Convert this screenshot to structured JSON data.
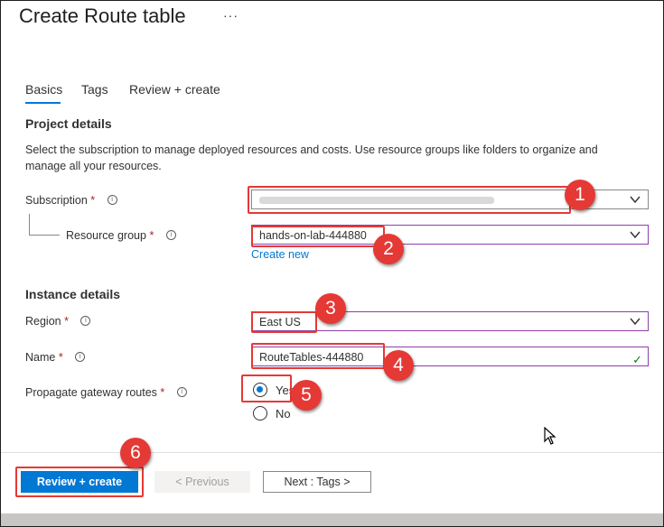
{
  "page_title": "Create Route table",
  "more_label": "···",
  "tabs": [
    {
      "label": "Basics",
      "active": true
    },
    {
      "label": "Tags",
      "active": false
    },
    {
      "label": "Review + create",
      "active": false
    }
  ],
  "project_details": {
    "heading": "Project details",
    "description": "Select the subscription to manage deployed resources and costs. Use resource groups like folders to organize and manage all your resources.",
    "subscription": {
      "label": "Subscription",
      "required": "*"
    },
    "resource_group": {
      "label": "Resource group",
      "required": "*",
      "value": "hands-on-lab-444880",
      "create_new": "Create new"
    }
  },
  "instance_details": {
    "heading": "Instance details",
    "region": {
      "label": "Region",
      "required": "*",
      "value": "East US"
    },
    "name": {
      "label": "Name",
      "required": "*",
      "value": "RouteTables-444880"
    },
    "propagate": {
      "label": "Propagate gateway routes",
      "required": "*",
      "options": [
        "Yes",
        "No"
      ],
      "selected": "Yes"
    }
  },
  "footer": {
    "review_create": "Review + create",
    "previous": "< Previous",
    "next": "Next : Tags >"
  },
  "annotations": [
    "1",
    "2",
    "3",
    "4",
    "5",
    "6"
  ],
  "colors": {
    "accent": "#0078d4",
    "annotation_red": "#e53935",
    "focus_purple": "#8e3fa8",
    "valid_green": "#107c10"
  }
}
